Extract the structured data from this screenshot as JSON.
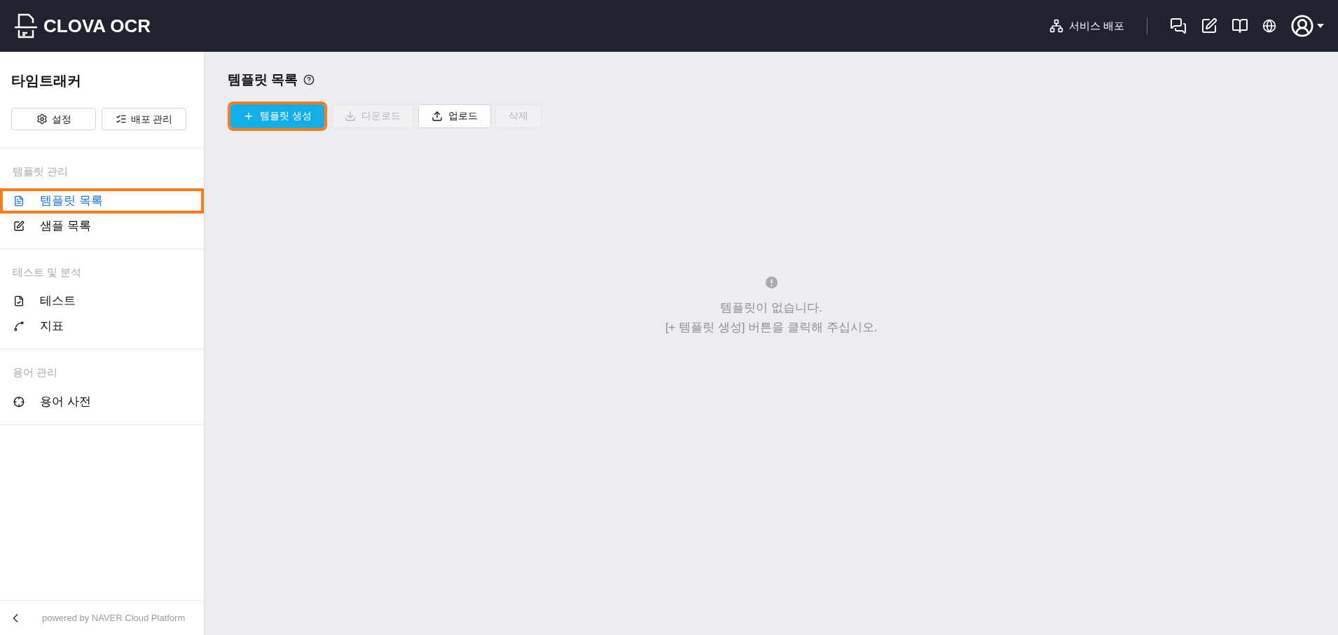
{
  "header": {
    "product": "CLOVA OCR",
    "deploy_label": "서비스 배포"
  },
  "sidebar": {
    "title": "타임트래커",
    "buttons": [
      "설정",
      "배포 관리"
    ],
    "sections": [
      {
        "heading": "템플릿 관리",
        "items": [
          {
            "label": "템플릿 목록",
            "kind": "list",
            "selected": true,
            "highlighted": true
          },
          {
            "label": "샘플 목록",
            "kind": "sample",
            "selected": false,
            "highlighted": false
          }
        ]
      },
      {
        "heading": "테스트 및 분석",
        "items": [
          {
            "label": "테스트",
            "kind": "test",
            "selected": false,
            "highlighted": false
          },
          {
            "label": "지표",
            "kind": "metric",
            "selected": false,
            "highlighted": false
          }
        ]
      },
      {
        "heading": "용어 관리",
        "items": [
          {
            "label": "용어 사전",
            "kind": "dictionary",
            "selected": false,
            "highlighted": false
          }
        ]
      }
    ],
    "footer": "powered by NAVER Cloud Platform"
  },
  "main": {
    "title": "템플릿 목록",
    "toolbar": [
      {
        "label": "템플릿 생성",
        "kind": "create",
        "disabled": false,
        "highlighted": true
      },
      {
        "label": "다운로드",
        "kind": "download",
        "disabled": true,
        "highlighted": false
      },
      {
        "label": "업로드",
        "kind": "upload",
        "disabled": false,
        "highlighted": false
      },
      {
        "label": "삭제",
        "kind": "delete",
        "disabled": true,
        "highlighted": false
      }
    ],
    "empty_message": [
      "템플릿이 없습니다.",
      "[+ 템플릿 생성] 버튼을 클릭해 주십시오."
    ]
  }
}
